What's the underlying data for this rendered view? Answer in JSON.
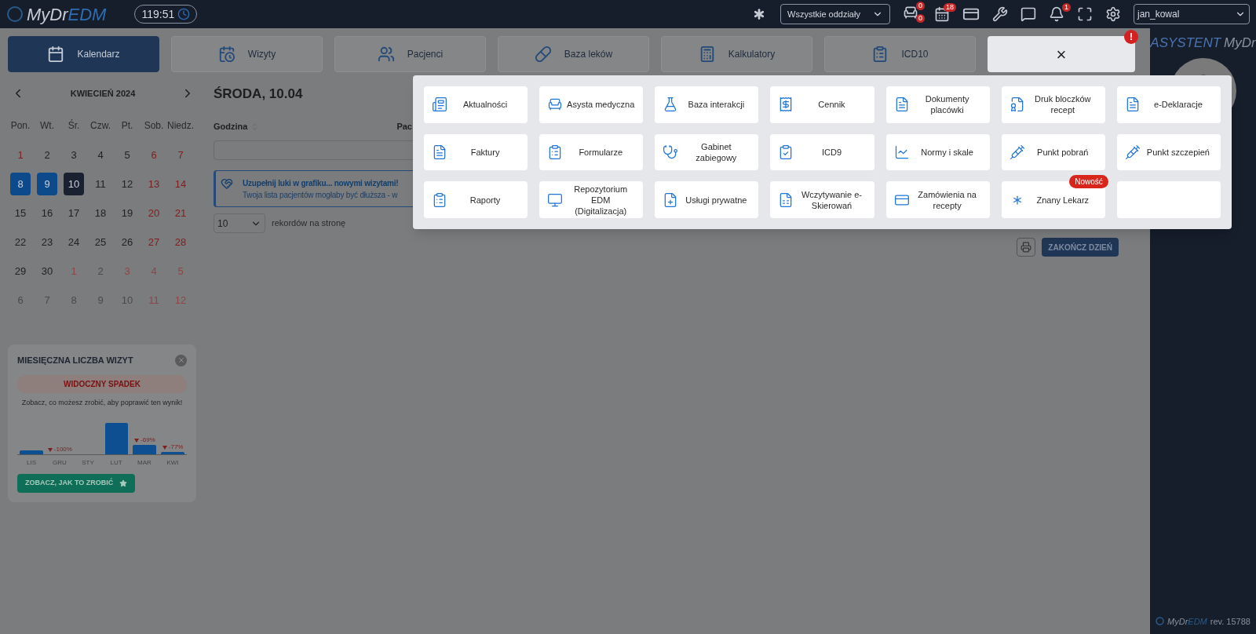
{
  "header": {
    "logo_my": "MyDr",
    "logo_edm": "EDM",
    "timer": "119:51",
    "branch_select": "Wszystkie oddziały",
    "visit_badges": [
      "0",
      "0"
    ],
    "calendar_badge": "18",
    "bell_badge": "1",
    "user_select": "jan_kowal"
  },
  "tabs": [
    {
      "label": "Kalendarz",
      "selected": true
    },
    {
      "label": "Wizyty",
      "selected": false
    },
    {
      "label": "Pacjenci",
      "selected": false
    },
    {
      "label": "Baza leków",
      "selected": false
    },
    {
      "label": "Kalkulatory",
      "selected": false
    },
    {
      "label": "ICD10",
      "selected": false
    }
  ],
  "close_tab": {
    "label": "×",
    "alert": "!"
  },
  "calendar": {
    "month": "KWIECIEŃ 2024",
    "weekdays": [
      "Pon.",
      "Wt.",
      "Śr.",
      "Czw.",
      "Pt.",
      "Sob.",
      "Niedz."
    ],
    "days": [
      {
        "d": "1",
        "red": true,
        "outside": false,
        "kind": "plain"
      },
      {
        "d": "2",
        "red": false,
        "outside": false,
        "kind": "plain"
      },
      {
        "d": "3",
        "red": false,
        "outside": false,
        "kind": "plain"
      },
      {
        "d": "4",
        "red": false,
        "outside": false,
        "kind": "plain"
      },
      {
        "d": "5",
        "red": false,
        "outside": false,
        "kind": "plain"
      },
      {
        "d": "6",
        "red": true,
        "outside": false,
        "kind": "plain"
      },
      {
        "d": "7",
        "red": true,
        "outside": false,
        "kind": "plain"
      },
      {
        "d": "8",
        "red": false,
        "outside": false,
        "kind": "booked"
      },
      {
        "d": "9",
        "red": false,
        "outside": false,
        "kind": "booked"
      },
      {
        "d": "10",
        "red": false,
        "outside": false,
        "kind": "today"
      },
      {
        "d": "11",
        "red": false,
        "outside": false,
        "kind": "plain"
      },
      {
        "d": "12",
        "red": false,
        "outside": false,
        "kind": "plain"
      },
      {
        "d": "13",
        "red": true,
        "outside": false,
        "kind": "plain"
      },
      {
        "d": "14",
        "red": true,
        "outside": false,
        "kind": "plain"
      },
      {
        "d": "15",
        "red": false,
        "outside": false,
        "kind": "plain"
      },
      {
        "d": "16",
        "red": false,
        "outside": false,
        "kind": "plain"
      },
      {
        "d": "17",
        "red": false,
        "outside": false,
        "kind": "plain"
      },
      {
        "d": "18",
        "red": false,
        "outside": false,
        "kind": "plain"
      },
      {
        "d": "19",
        "red": false,
        "outside": false,
        "kind": "plain"
      },
      {
        "d": "20",
        "red": true,
        "outside": false,
        "kind": "plain"
      },
      {
        "d": "21",
        "red": true,
        "outside": false,
        "kind": "plain"
      },
      {
        "d": "22",
        "red": false,
        "outside": false,
        "kind": "plain"
      },
      {
        "d": "23",
        "red": false,
        "outside": false,
        "kind": "plain"
      },
      {
        "d": "24",
        "red": false,
        "outside": false,
        "kind": "plain"
      },
      {
        "d": "25",
        "red": false,
        "outside": false,
        "kind": "plain"
      },
      {
        "d": "26",
        "red": false,
        "outside": false,
        "kind": "plain"
      },
      {
        "d": "27",
        "red": true,
        "outside": false,
        "kind": "plain"
      },
      {
        "d": "28",
        "red": true,
        "outside": false,
        "kind": "plain"
      },
      {
        "d": "29",
        "red": false,
        "outside": false,
        "kind": "plain"
      },
      {
        "d": "30",
        "red": false,
        "outside": false,
        "kind": "plain"
      },
      {
        "d": "1",
        "red": true,
        "outside": true,
        "kind": "plain"
      },
      {
        "d": "2",
        "red": false,
        "outside": true,
        "kind": "plain"
      },
      {
        "d": "3",
        "red": true,
        "outside": true,
        "kind": "plain"
      },
      {
        "d": "4",
        "red": true,
        "outside": true,
        "kind": "plain"
      },
      {
        "d": "5",
        "red": true,
        "outside": true,
        "kind": "plain"
      },
      {
        "d": "6",
        "red": false,
        "outside": true,
        "kind": "plain"
      },
      {
        "d": "7",
        "red": false,
        "outside": true,
        "kind": "plain"
      },
      {
        "d": "8",
        "red": false,
        "outside": true,
        "kind": "plain"
      },
      {
        "d": "9",
        "red": false,
        "outside": true,
        "kind": "plain"
      },
      {
        "d": "10",
        "red": false,
        "outside": true,
        "kind": "plain"
      },
      {
        "d": "11",
        "red": true,
        "outside": true,
        "kind": "plain"
      },
      {
        "d": "12",
        "red": true,
        "outside": true,
        "kind": "plain"
      }
    ]
  },
  "visits_widget": {
    "title": "MIESIĘCZNA LICZBA WIZYT",
    "status": "WIDOCZNY SPADEK",
    "hint": "Zobacz, co możesz zrobić, aby poprawić ten wynik!",
    "months": [
      {
        "label": "LIS"
      },
      {
        "label": "GRU",
        "change": "-100%"
      },
      {
        "label": "STY"
      },
      {
        "label": "LUT"
      },
      {
        "label": "MAR",
        "change": "-69%"
      },
      {
        "label": "KWI",
        "change": "-77%"
      }
    ],
    "button": "ZOBACZ, JAK TO ZROBIĆ"
  },
  "day_view": {
    "title": "ŚRODA, 10.04",
    "columns": [
      "Godzina",
      "Pac"
    ],
    "banner": {
      "title": "Uzupełnij luki w grafiku... nowymi wizytami!",
      "text": "Twoja lista pacjentów mogłaby być dłuższa - w"
    },
    "per_page": "10",
    "per_page_label": "rekordów na stronę",
    "end_day_button": "ZAKOŃCZ DZIEŃ"
  },
  "menu": [
    {
      "kind": "link",
      "label": "Aktualności"
    },
    {
      "kind": "link",
      "label": "Asysta medyczna"
    },
    {
      "kind": "link",
      "label": "Baza interakcji"
    },
    {
      "kind": "link",
      "label": "Cennik"
    },
    {
      "kind": "link",
      "label": "Dokumenty placówki"
    },
    {
      "kind": "link",
      "label": "Druk bloczków recept"
    },
    {
      "kind": "link",
      "label": "e-Deklaracje"
    },
    {
      "kind": "link",
      "label": "Faktury"
    },
    {
      "kind": "link",
      "label": "Formularze"
    },
    {
      "kind": "link",
      "label": "Gabinet zabiegowy"
    },
    {
      "kind": "link",
      "label": "ICD9"
    },
    {
      "kind": "link",
      "label": "Normy i skale"
    },
    {
      "kind": "link",
      "label": "Punkt pobrań"
    },
    {
      "kind": "link",
      "label": "Punkt szczepień"
    },
    {
      "kind": "link",
      "label": "Raporty"
    },
    {
      "kind": "link",
      "label": "Repozytorium EDM (Digitalizacja)"
    },
    {
      "kind": "link",
      "label": "Usługi prywatne"
    },
    {
      "kind": "link",
      "label": "Wczytywanie e-Skierowań"
    },
    {
      "kind": "link",
      "label": "Zamówienia na recepty"
    },
    {
      "kind": "link",
      "label": "Znany Lekarz",
      "badge": "Nowość"
    },
    {
      "kind": "blank"
    }
  ],
  "assistant": {
    "title_a": "ASYSTENT",
    "title_b": "MyDr",
    "footer_my": "MyDr",
    "footer_edm": "EDM",
    "revision": "rev. 15788"
  }
}
